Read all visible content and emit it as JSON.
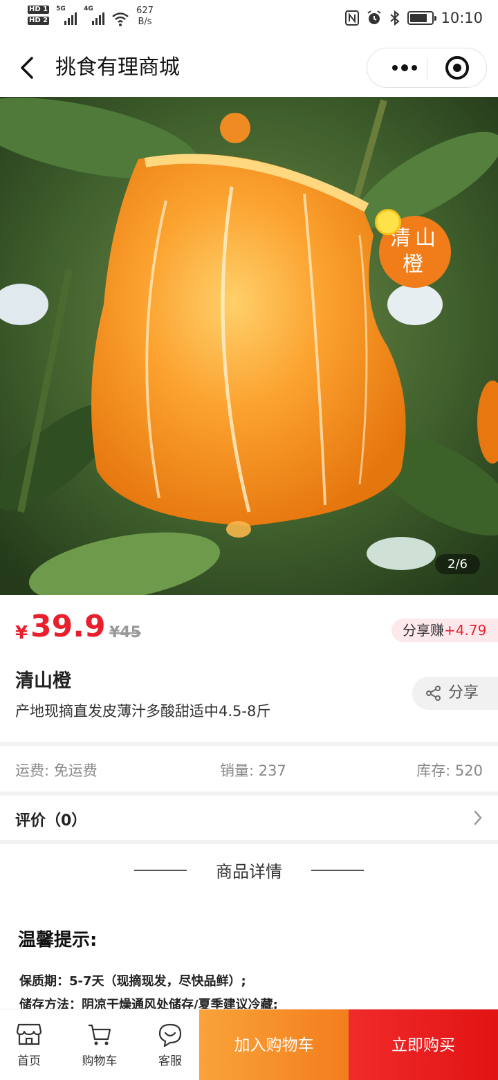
{
  "status_bar": {
    "hd1": "HD 1",
    "hd2": "HD 2",
    "sig1_label": "5G",
    "sig2_label": "4G",
    "net_speed_value": "627",
    "net_speed_unit": "B/s",
    "time": "10:10",
    "battery_level": 0.8
  },
  "nav": {
    "title": "挑食有理商城"
  },
  "hero": {
    "pager": "2/6",
    "badge_line1": "清山",
    "badge_line2": "橙"
  },
  "product": {
    "currency": "¥",
    "price": "39.9",
    "original_price": "¥45",
    "share_earn_label": "分享赚",
    "share_earn_amount": "+4.79",
    "name": "清山橙",
    "description": "产地现摘直发皮薄汁多酸甜适中4.5-8斤",
    "share_label": "分享"
  },
  "info": {
    "shipping_label": "运费:",
    "shipping_value": "免运费",
    "sales_label": "销量:",
    "sales_value": "237",
    "stock_label": "库存:",
    "stock_value": "520"
  },
  "reviews": {
    "label": "评价（0）"
  },
  "detail": {
    "title": "商品详情",
    "tips_title": "温馨提示:",
    "tip1": "保质期：5-7天（现摘现发，尽快品鲜）;",
    "tip2": "储存方法：阴凉干燥通风处储存/夏季建议冷藏;"
  },
  "bottom": {
    "home_label": "首页",
    "cart_label": "购物车",
    "service_label": "客服",
    "add_to_cart": "加入购物车",
    "buy_now": "立即购买"
  },
  "colors": {
    "accent_red": "#e8202d",
    "cart_orange": "#f37d1c",
    "buy_red": "#e21414"
  }
}
